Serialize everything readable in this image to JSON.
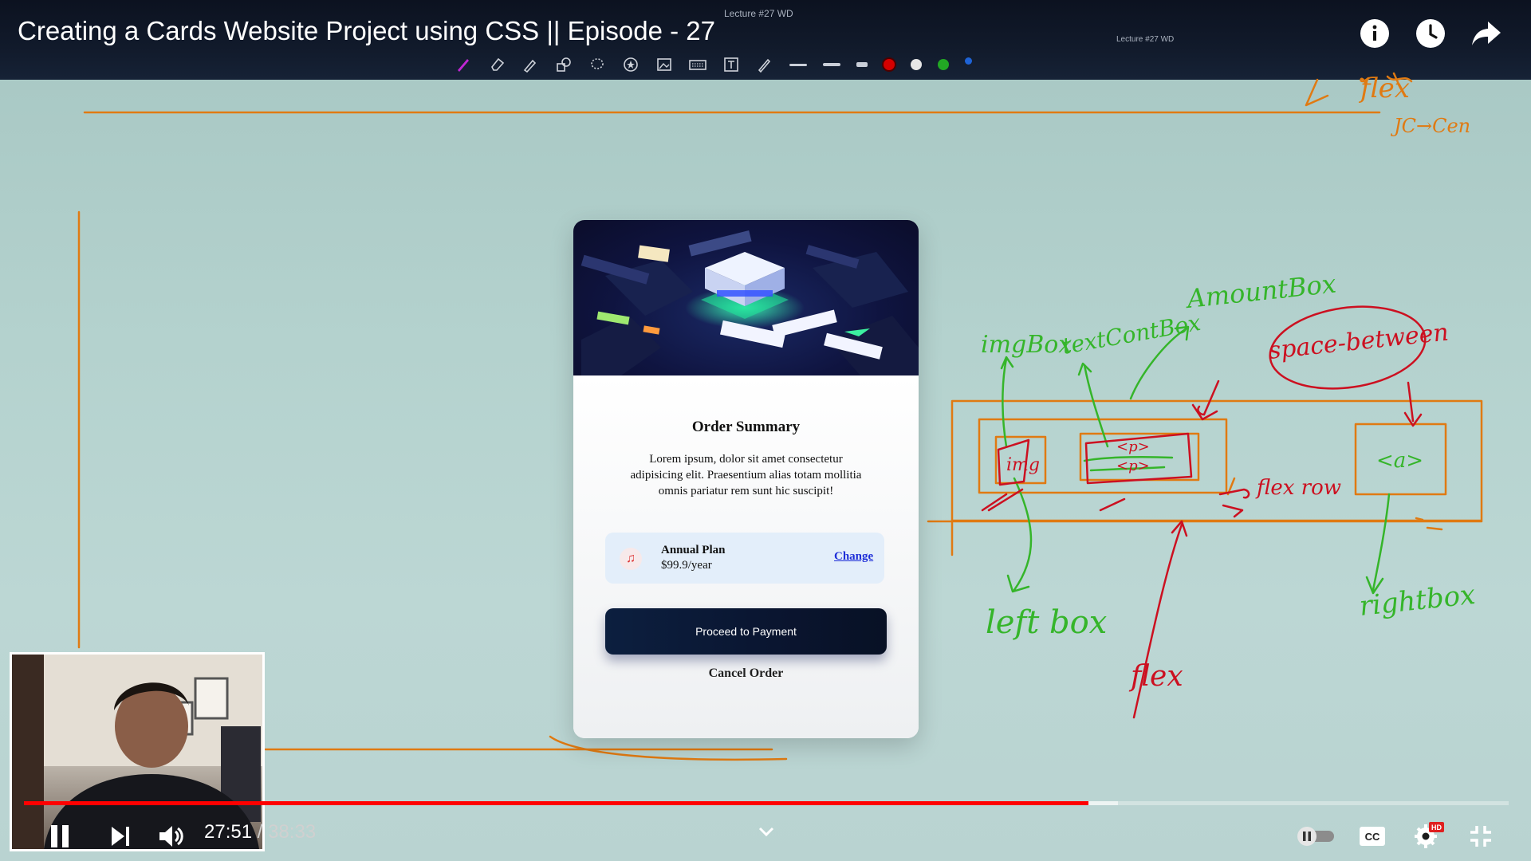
{
  "video": {
    "title": "Creating a Cards Website Project using CSS || Episode - 27",
    "lecture_label": "Lecture #27 WD",
    "lecture_label_small": "Lecture #27 WD",
    "current_time": "27:51",
    "separator": "/",
    "duration": "38:33",
    "progress_played": 0.717,
    "progress_buffered": 0.737,
    "hd_badge": "HD"
  },
  "top_icons": [
    "info-icon",
    "watch-later-icon",
    "share-icon"
  ],
  "toolbar": {
    "tools": [
      "pen-icon",
      "eraser-icon",
      "highlighter-icon",
      "shapes-icon",
      "lasso-icon",
      "stamp-icon",
      "image-icon",
      "keyboard-icon",
      "text-icon",
      "pointer-pen-icon"
    ],
    "swatches": [
      "#d40000",
      "#e6e6e6",
      "#22a824",
      "#1e63d6"
    ]
  },
  "card": {
    "title": "Order Summary",
    "description": "Lorem ipsum, dolor sit amet consectetur adipisicing elit. Praesentium alias totam mollitia omnis pariatur rem sunt hic suscipit!",
    "plan_name": "Annual Plan",
    "plan_price": "$99.9/year",
    "change_link": "Change",
    "pay_button": "Proceed to Payment",
    "cancel_button": "Cancel Order"
  },
  "annotations": {
    "img_box": "imgBox",
    "text_box": "textContBox",
    "amount_box": "AmountBox",
    "space_between": "space-between",
    "img_tag": "img",
    "p_tag": "<p>",
    "p_tag2": "<p>",
    "a_tag": "<a>",
    "flex_row": "flex row",
    "left_box": "left box",
    "flex": "flex",
    "right_box": "rightbox",
    "top_flex": "flex",
    "top_jc": "JC→Cen"
  },
  "colors": {
    "orange": "#e07a12",
    "green": "#35b52a",
    "red": "#cc1020",
    "progress_red": "#ff0000"
  }
}
